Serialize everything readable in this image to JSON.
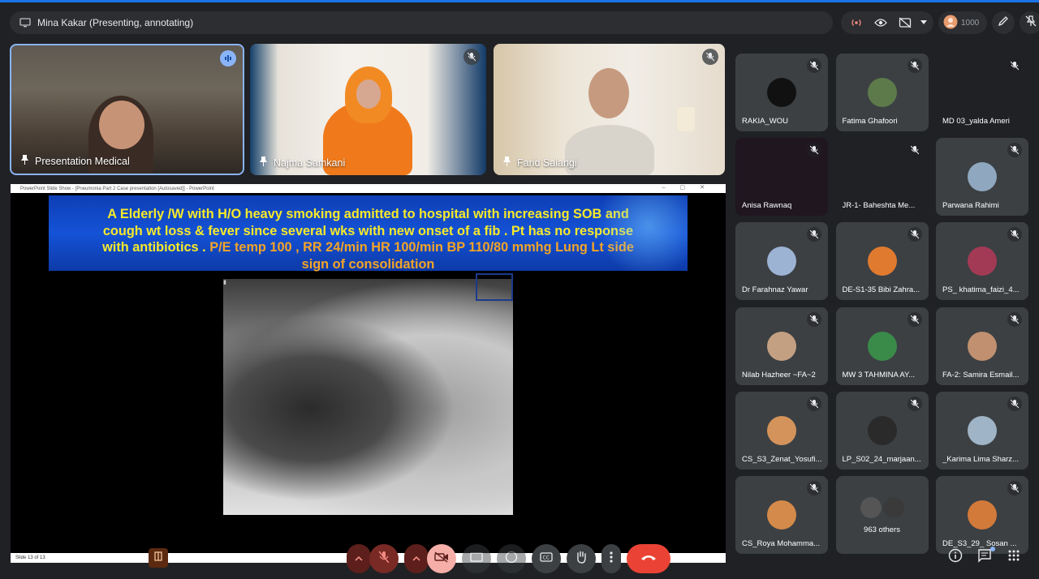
{
  "presenter": {
    "label": "Mina Kakar (Presenting, annotating)"
  },
  "top_tools": {
    "viewer_count": "1000"
  },
  "videos": [
    {
      "name": "Presentation Medical"
    },
    {
      "name": "Najma Samkani"
    },
    {
      "name": "Farid Salangi"
    }
  ],
  "powerpoint": {
    "title_bar": "PowerPoint Slide Show - [Pneumonia Part 2 Case presentation [Autosaved]] - PowerPoint",
    "status": "Slide 13 of 13"
  },
  "slide": {
    "line1": "A Elderly /W with H/O heavy smoking admitted to hospital with increasing SOB and",
    "line2": "cough wt loss  & fever since several wks with new onset of a fib . Pt has no response",
    "line3a": "with antibiotics . ",
    "line3b": "P/E  temp 100 , RR 24/min HR 100/min BP 110/80 mmhg  Lung Lt side",
    "line4": "sign of consolidation"
  },
  "participants": [
    {
      "name": "RAKIA_WOU",
      "color": "#111111"
    },
    {
      "name": "Fatima Ghafoori",
      "color": "#5d7a4a"
    },
    {
      "name": "MD 03_yalda Ameri",
      "color": "#1a1a1a"
    },
    {
      "name": "Anisa Rawnaq",
      "color": "#3a1f33"
    },
    {
      "name": "JR-1- Baheshta Me...",
      "color": "#2b2630"
    },
    {
      "name": "Parwana Rahimi",
      "color": "#8fa8bf"
    },
    {
      "name": "Dr Farahnaz Yawar",
      "color": "#9db3d4"
    },
    {
      "name": "DE-S1-35 Bibi Zahra...",
      "color": "#e07a2f"
    },
    {
      "name": "PS_ khatima_faizi_4...",
      "color": "#a33a55"
    },
    {
      "name": "Nilab Hazheer ~FA~2",
      "color": "#c4a083"
    },
    {
      "name": "MW 3 TAHMINA AY...",
      "color": "#3a8a4a"
    },
    {
      "name": "FA-2: Samira Esmail...",
      "color": "#c09070"
    },
    {
      "name": "CS_S3_Zenat_Yosufi...",
      "color": "#d4935a"
    },
    {
      "name": "LP_S02_24_marjaan...",
      "color": "#2a2a2a"
    },
    {
      "name": "_Karima Lima Sharz...",
      "color": "#9fb4c6"
    },
    {
      "name": "CS_Roya Mohamma...",
      "color": "#d48a4a"
    },
    {
      "name": "963 others",
      "color": "#555555"
    },
    {
      "name": "DE_S3_29_ Sosan ...",
      "color": "#d27a3a"
    }
  ]
}
